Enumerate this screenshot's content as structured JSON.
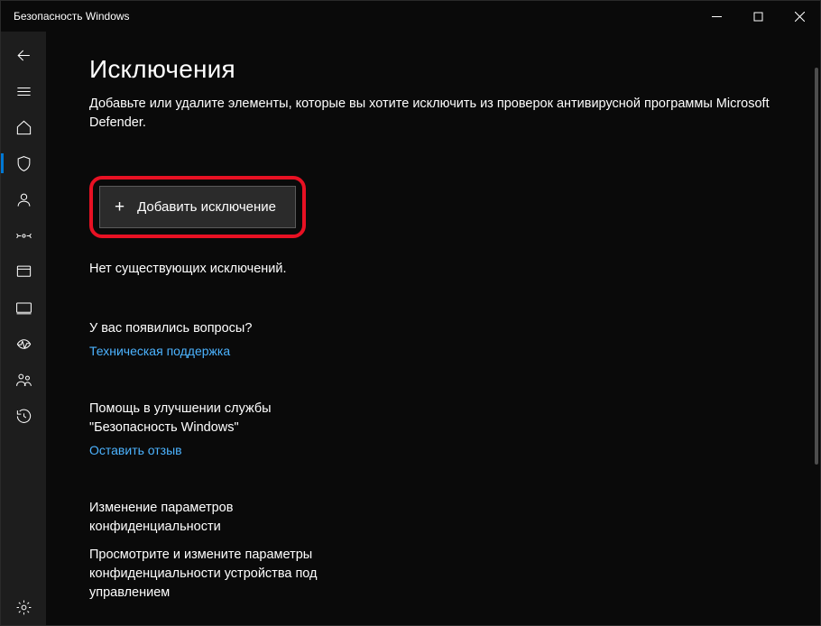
{
  "window": {
    "title": "Безопасность Windows"
  },
  "page": {
    "title": "Исключения",
    "description": "Добавьте или удалите элементы, которые вы хотите исключить из проверок антивирусной программы Microsoft Defender.",
    "add_button": "Добавить исключение",
    "empty_state": "Нет существующих исключений."
  },
  "sections": {
    "help": {
      "heading": "У вас появились вопросы?",
      "link": "Техническая поддержка"
    },
    "feedback": {
      "heading": "Помощь в улучшении службы \"Безопасность Windows\"",
      "link": "Оставить отзыв"
    },
    "privacy": {
      "heading": "Изменение параметров конфиденциальности",
      "sub": "Просмотрите и измените параметры конфиденциальности устройства под управлением"
    }
  },
  "sidebar": {
    "back": "back",
    "menu": "menu",
    "items": [
      {
        "name": "home"
      },
      {
        "name": "virus-protection",
        "active": true
      },
      {
        "name": "account-protection"
      },
      {
        "name": "firewall"
      },
      {
        "name": "app-browser-control"
      },
      {
        "name": "device-security"
      },
      {
        "name": "device-performance"
      },
      {
        "name": "family-options"
      },
      {
        "name": "protection-history"
      }
    ],
    "settings": "settings"
  }
}
